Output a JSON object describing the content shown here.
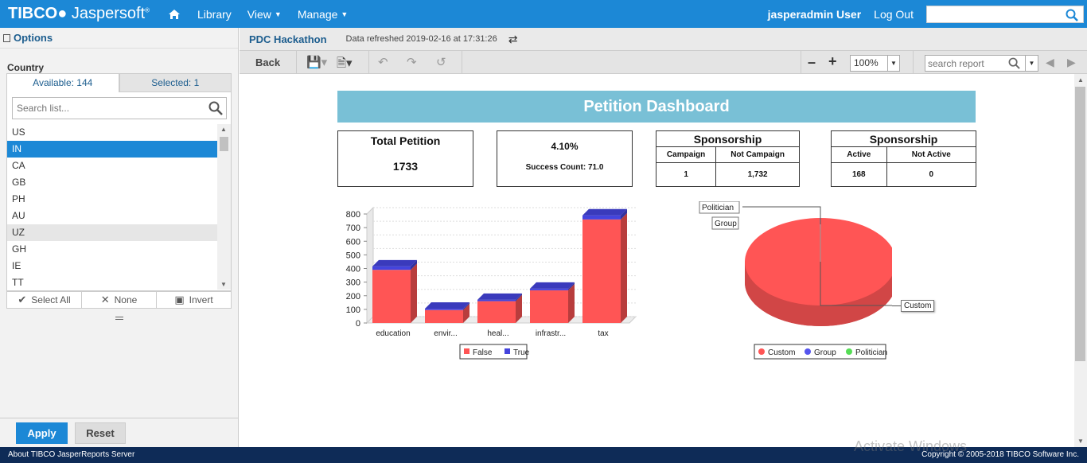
{
  "nav": {
    "logo_brand": "TIBCO",
    "logo_product": "Jaspersoft",
    "library": "Library",
    "view": "View",
    "manage": "Manage",
    "user": "jasperadmin User",
    "logout": "Log Out",
    "search_value": ""
  },
  "options": {
    "title": "Options",
    "country_label": "Country",
    "tab_available": "Available: 144",
    "tab_selected": "Selected: 1",
    "search_placeholder": "Search list...",
    "countries": [
      "US",
      "IN",
      "CA",
      "GB",
      "PH",
      "AU",
      "UZ",
      "GH",
      "IE",
      "TT"
    ],
    "selected_country": "IN",
    "hovered_country": "UZ",
    "select_all": "Select All",
    "none": "None",
    "invert": "Invert",
    "apply": "Apply",
    "reset": "Reset"
  },
  "report": {
    "title": "PDC Hackathon",
    "refreshed": "Data refreshed 2019-02-16 at 17:31:26",
    "back": "Back",
    "zoom": "100%",
    "search_placeholder": "search report"
  },
  "dashboard": {
    "title": "Petition Dashboard",
    "total_label": "Total Petition",
    "total_value": "1733",
    "success_rate": "4.10%",
    "success_count": "Success Count: 71.0",
    "sponsorship1": {
      "title": "Sponsorship",
      "col1": "Campaign",
      "col2": "Not Campaign",
      "val1": "1",
      "val2": "1,732"
    },
    "sponsorship2": {
      "title": "Sponsorship",
      "col1": "Active",
      "col2": "Not Active",
      "val1": "168",
      "val2": "0"
    }
  },
  "chart_data": [
    {
      "type": "bar",
      "stacked": true,
      "categories": [
        "education",
        "envir...",
        "heal...",
        "infrastr...",
        "tax"
      ],
      "series": [
        {
          "name": "False",
          "color": "#ff5555",
          "values": [
            390,
            95,
            160,
            240,
            760
          ]
        },
        {
          "name": "True",
          "color": "#4444dd",
          "values": [
            25,
            10,
            10,
            12,
            30
          ]
        }
      ],
      "ylim": [
        0,
        800
      ],
      "yticks": [
        0,
        100,
        200,
        300,
        400,
        500,
        600,
        700,
        800
      ],
      "legend_position": "bottom"
    },
    {
      "type": "pie",
      "labels": [
        "Custom",
        "Group",
        "Politician"
      ],
      "values": [
        1731,
        1,
        1
      ],
      "colors": [
        "#ff5555",
        "#5555ee",
        "#55dd55"
      ],
      "legend_position": "bottom"
    }
  ],
  "footer": {
    "left": "About TIBCO JasperReports Server",
    "right": "Copyright © 2005-2018 TIBCO Software Inc."
  },
  "watermark": "Activate Windows"
}
